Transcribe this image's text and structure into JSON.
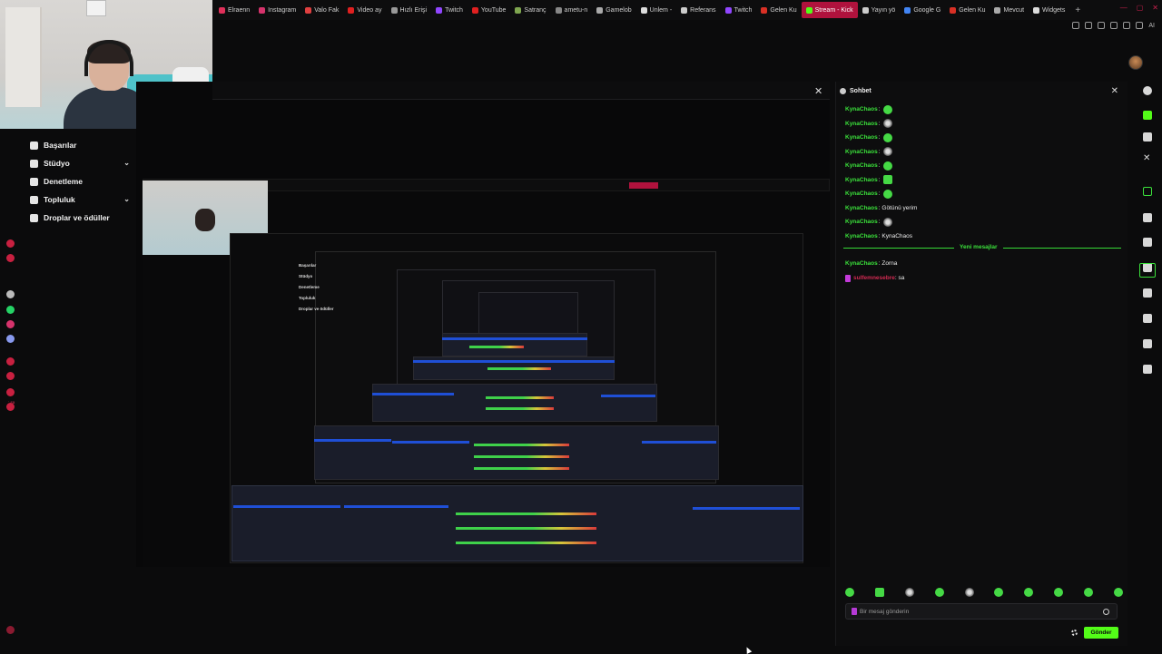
{
  "bookmarks": [
    {
      "label": "Elraenn",
      "color": "#e0305a"
    },
    {
      "label": "Instagram",
      "color": "#d6336c"
    },
    {
      "label": "Valo Fak",
      "color": "#e04040"
    },
    {
      "label": "Video ay",
      "color": "#e02020"
    },
    {
      "label": "Hızlı Erişi",
      "color": "#999999"
    },
    {
      "label": "Twitch",
      "color": "#9146ff"
    },
    {
      "label": "YouTube",
      "color": "#e02020"
    },
    {
      "label": "Satranç",
      "color": "#7fa650"
    },
    {
      "label": "ametu-n",
      "color": "#888888"
    },
    {
      "label": "Gamelob",
      "color": "#aaaaaa"
    },
    {
      "label": "Unlem -",
      "color": "#dddddd"
    },
    {
      "label": "Referans",
      "color": "#cccccc"
    },
    {
      "label": "Twitch",
      "color": "#9146ff"
    },
    {
      "label": "Gelen Ku",
      "color": "#d93025"
    },
    {
      "label": "Stream - Kick",
      "color": "#53fc18",
      "active": true
    },
    {
      "label": "Yayın yö",
      "color": "#cccccc"
    },
    {
      "label": "Google G",
      "color": "#4285f4"
    },
    {
      "label": "Gelen Ku",
      "color": "#d93025"
    },
    {
      "label": "Mevcut",
      "color": "#aaaaaa"
    },
    {
      "label": "Widgets",
      "color": "#dddddd"
    }
  ],
  "browser_toolbar": {
    "ai_label": "AI"
  },
  "sidebar": {
    "items": [
      {
        "label": "Başarılar",
        "icon": "trophy-icon"
      },
      {
        "label": "Stüdyo",
        "icon": "studio-icon",
        "expandable": true
      },
      {
        "label": "Denetleme",
        "icon": "shield-icon"
      },
      {
        "label": "Topluluk",
        "icon": "community-icon",
        "expandable": true
      },
      {
        "label": "Droplar ve ödüller",
        "icon": "gift-icon"
      }
    ],
    "mini_chat_preview": "                   : sa"
  },
  "stream_preview": {
    "nested_nav": [
      "Başarılar",
      "Stüdyo",
      "Denetleme",
      "Topluluk",
      "Droplar ve ödüller"
    ]
  },
  "chat": {
    "title": "Sohbet",
    "messages": [
      {
        "user": "KynaChaos",
        "text": "",
        "emote": "green"
      },
      {
        "user": "KynaChaos",
        "text": "",
        "emote": "gray"
      },
      {
        "user": "KynaChaos",
        "text": "",
        "emote": "green"
      },
      {
        "user": "KynaChaos",
        "text": "",
        "emote": "gray"
      },
      {
        "user": "KynaChaos",
        "text": "",
        "emote": "green"
      },
      {
        "user": "KynaChaos",
        "text": "",
        "emote": "sq"
      },
      {
        "user": "KynaChaos",
        "text": "",
        "emote": "green"
      },
      {
        "user": "KynaChaos",
        "text": "Götünü yerim",
        "emote": ""
      },
      {
        "user": "KynaChaos",
        "text": "",
        "emote": "gray"
      },
      {
        "user": "KynaChaos",
        "text": "KynaChaos",
        "emote": ""
      }
    ],
    "divider_label": "Yeni mesajlar",
    "new_messages": [
      {
        "user": "KynaChaos",
        "text": "Zorna",
        "kind": "regular"
      },
      {
        "user": "sulfemnesebre",
        "text": "sa",
        "kind": "mod"
      }
    ],
    "emote_bar": [
      "green",
      "sq",
      "gray",
      "green",
      "gray",
      "green",
      "green",
      "green",
      "green",
      "green"
    ],
    "input_placeholder": "Bir mesaj gönderin",
    "send_label": "Gönder"
  },
  "colors": {
    "kick_green": "#53fc18",
    "username_green": "#3be13b",
    "mod_red": "#d22a52",
    "active_tab": "#b0123d"
  }
}
